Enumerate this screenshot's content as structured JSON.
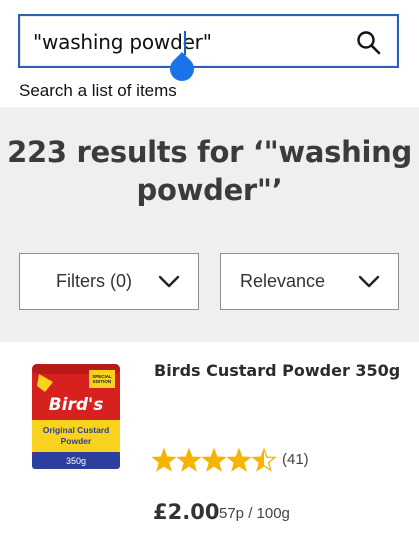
{
  "search": {
    "query": "\"washing powder\"",
    "label": "Search a list of items",
    "button_icon": "search-icon"
  },
  "results": {
    "line1": "223 results for ‘\"washing",
    "line2": "powder\"’"
  },
  "filters": {
    "label": "Filters (0)",
    "icon": "chevron-down-icon"
  },
  "sort": {
    "label": "Relevance",
    "icon": "chevron-down-icon"
  },
  "product": {
    "name": "Birds Custard Powder 350g",
    "rating": 4.5,
    "rating_max": 5,
    "review_count": "(41)",
    "price": "£2.00",
    "unit_price": "57p / 100g",
    "image": {
      "banner": "SPECIAL EDITION",
      "brand": "Bird's",
      "line1": "Original Custard",
      "line2": "Powder",
      "size": "350g"
    }
  },
  "colors": {
    "search_border": "#2a61b6",
    "cursor": "#1a73e8",
    "panel_bg": "#efefef",
    "star": "#f5b400",
    "pack_red": "#d7211f",
    "pack_blue": "#2d3e9c",
    "pack_yellow": "#f7d21e"
  }
}
